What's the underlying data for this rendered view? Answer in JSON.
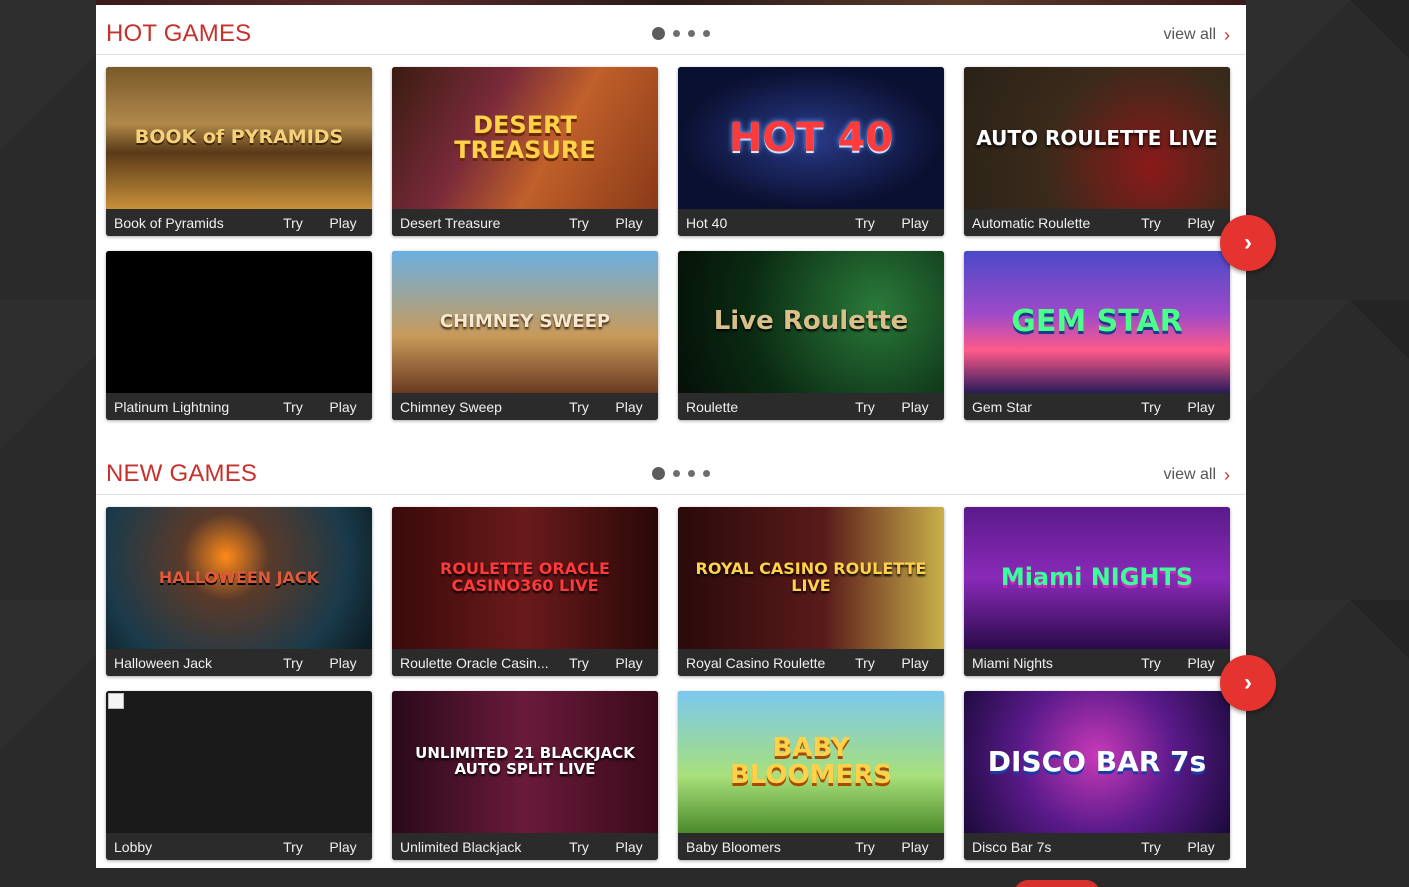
{
  "hot_games": {
    "title": "HOT GAMES",
    "view_all": "view all",
    "games": [
      {
        "name": "Book of Pyramids",
        "art": "BOOK of PYRAMIDS",
        "try": "Try",
        "play": "Play"
      },
      {
        "name": "Desert Treasure",
        "art": "DESERT TREASURE",
        "try": "Try",
        "play": "Play"
      },
      {
        "name": "Hot 40",
        "art": "HOT 40",
        "try": "Try",
        "play": "Play"
      },
      {
        "name": "Automatic Roulette",
        "art": "AUTO ROULETTE LIVE",
        "try": "Try",
        "play": "Play"
      },
      {
        "name": "Platinum Lightning",
        "art": "",
        "try": "Try",
        "play": "Play"
      },
      {
        "name": "Chimney Sweep",
        "art": "CHIMNEY SWEEP",
        "try": "Try",
        "play": "Play"
      },
      {
        "name": "Roulette",
        "art": "Live Roulette",
        "try": "Try",
        "play": "Play"
      },
      {
        "name": "Gem Star",
        "art": "GEM STAR",
        "try": "Try",
        "play": "Play"
      }
    ]
  },
  "new_games": {
    "title": "NEW GAMES",
    "view_all": "view all",
    "games": [
      {
        "name": "Halloween Jack",
        "art": "HALLOWEEN JACK",
        "try": "Try",
        "play": "Play"
      },
      {
        "name": "Roulette Oracle Casin...",
        "art": "ROULETTE ORACLE CASINO360 LIVE",
        "try": "Try",
        "play": "Play"
      },
      {
        "name": "Royal Casino Roulette",
        "art": "ROYAL CASINO ROULETTE LIVE",
        "try": "Try",
        "play": "Play"
      },
      {
        "name": "Miami Nights",
        "art": "Miami NIGHTS",
        "try": "Try",
        "play": "Play"
      },
      {
        "name": "Lobby",
        "art": "",
        "try": "Try",
        "play": "Play"
      },
      {
        "name": "Unlimited Blackjack",
        "art": "UNLIMITED 21 BLACKJACK AUTO SPLIT LIVE",
        "try": "Try",
        "play": "Play"
      },
      {
        "name": "Baby Bloomers",
        "art": "BABY BLOOMERS",
        "try": "Try",
        "play": "Play"
      },
      {
        "name": "Disco Bar 7s",
        "art": "DISCO BAR 7s",
        "try": "Try",
        "play": "Play"
      }
    ]
  },
  "colors": {
    "accent": "#c8312b",
    "arrow": "#e53430",
    "card_bar": "#2b2b2b"
  },
  "icons": {
    "view_all": "chevron-right-icon",
    "next": "chevron-right-icon"
  },
  "next_label": "›",
  "chevron_label": "›"
}
